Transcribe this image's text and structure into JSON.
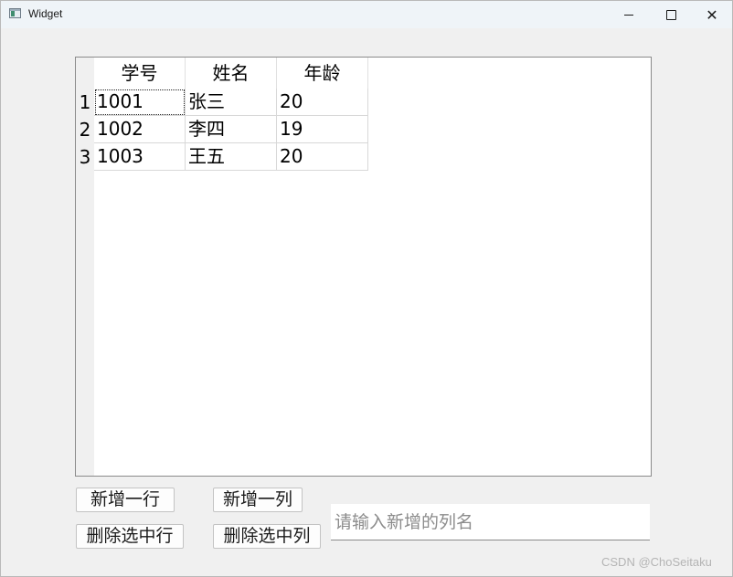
{
  "window": {
    "title": "Widget",
    "icon": "app-window-icon",
    "controls": {
      "minimize_icon": "minimize-icon",
      "maximize_icon": "maximize-icon",
      "close_glyph": "✕"
    }
  },
  "table": {
    "columns": [
      "学号",
      "姓名",
      "年龄"
    ],
    "row_headers": [
      "1",
      "2",
      "3"
    ],
    "rows": [
      [
        "1001",
        "张三",
        "20"
      ],
      [
        "1002",
        "李四",
        "19"
      ],
      [
        "1003",
        "王五",
        "20"
      ]
    ],
    "current_cell": [
      0,
      0
    ]
  },
  "buttons": {
    "add_row": "新增一行",
    "add_column": "新增一列",
    "delete_row": "删除选中行",
    "delete_column": "删除选中列"
  },
  "column_name_input": {
    "value": "",
    "placeholder": "请输入新增的列名"
  },
  "watermark": "CSDN @ChoSeitaku"
}
